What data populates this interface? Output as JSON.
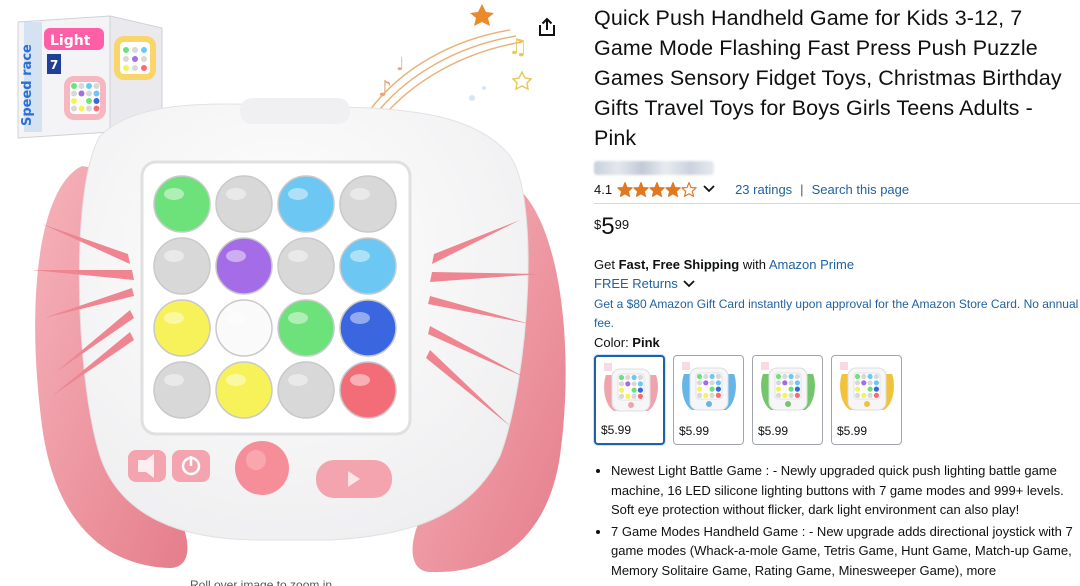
{
  "product": {
    "title": "Quick Push Handheld Game for Kids 3-12, 7 Game Mode Flashing Fast Press Push Puzzle Games Sensory Fidget Toys, Christmas Birthday Gifts Travel Toys for Boys Girls Teens Adults - Pink",
    "rating": "4.1",
    "rating_value": 4.1,
    "ratings_link": "23 ratings",
    "search_link": "Search this page",
    "price": {
      "symbol": "$",
      "whole": "5",
      "fraction": "99"
    },
    "shipping": {
      "prefix": "Get ",
      "bold": "Fast, Free Shipping",
      "middle": " with ",
      "link": "Amazon Prime"
    },
    "returns": "FREE Returns",
    "promo": "Get a $80 Amazon Gift Card instantly upon approval for the Amazon Store Card. No annual fee.",
    "color_label": "Color: ",
    "color_value": "Pink",
    "swatches": [
      {
        "price": "$5.99",
        "color": "#f1a3ad"
      },
      {
        "price": "$5.99",
        "color": "#66b5e8"
      },
      {
        "price": "$5.99",
        "color": "#74c66b"
      },
      {
        "price": "$5.99",
        "color": "#f2c23a"
      }
    ],
    "bullets": [
      "Newest Light Battle Game : - Newly upgraded quick push lighting battle game machine, 16 LED silicone lighting buttons with 7 game modes and 999+ levels. Soft eye protection without flicker, dark light environment can also play!",
      "7 Game Modes Handheld Game : - New upgrade adds directional joystick with 7 game modes (Whack-a-mole Game, Tetris Game, Hunt Game, Match-up Game, Memory Solitaire Game, Rating Game, Minesweeper Game), more"
    ]
  },
  "image": {
    "box_text": {
      "brand": "Light",
      "tag": "Speed race",
      "modes": "7"
    },
    "caption": "Roll over image to zoom in",
    "button_colors": [
      "#6ee27a",
      "#d8d8d8",
      "#6cc8f2",
      "#d8d8d8",
      "#d8d8d8",
      "#a56ce8",
      "#d8d8d8",
      "#6cc8f2",
      "#f7f25a",
      "#fafafa",
      "#6ee27a",
      "#3a66e0",
      "#d8d8d8",
      "#f7f25a",
      "#d8d8d8",
      "#f36d78"
    ],
    "accent": "#f28f99"
  },
  "colors": {
    "link": "#2162a1",
    "star": "#de7921"
  }
}
